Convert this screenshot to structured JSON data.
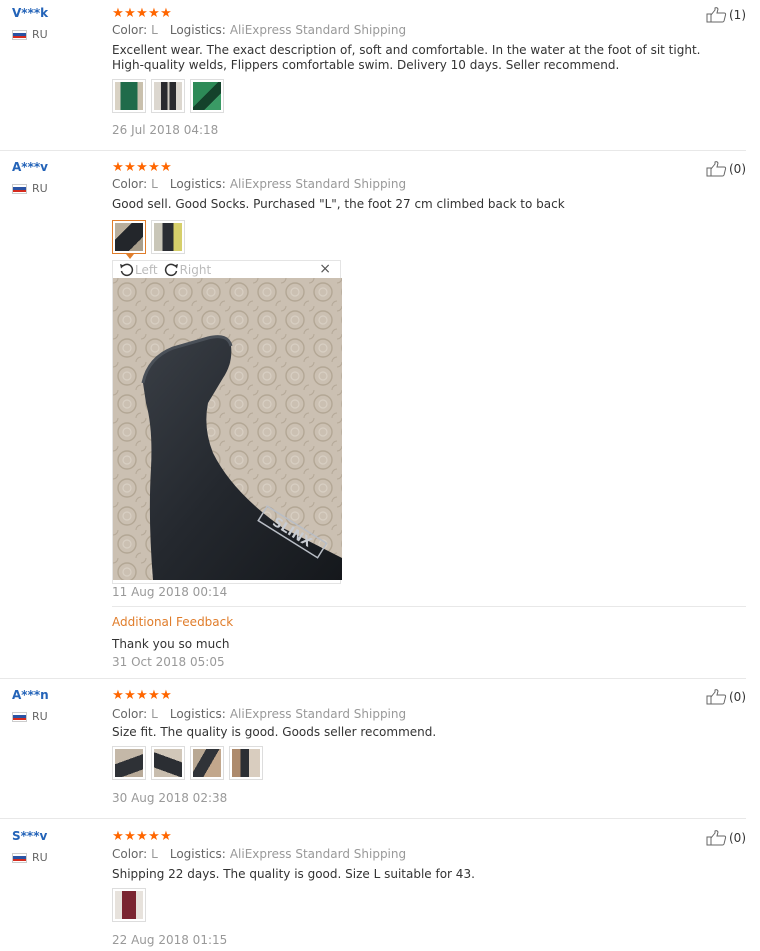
{
  "reviews": [
    {
      "user": "V***k",
      "country": "RU",
      "stars": 5,
      "helpful_label": "(1)",
      "color_key": "Color:",
      "color_val": "L",
      "logistics_key": "Logistics:",
      "logistics_val": "AliExpress Standard Shipping",
      "text": "Excellent wear. The exact description of, soft and comfortable. In the water at the foot of sit tight. High-quality welds, Flippers comfortable swim. Delivery 10 days. Seller recommend.",
      "date": "26 Jul 2018 04:18"
    },
    {
      "user": "A***v",
      "country": "RU",
      "stars": 5,
      "helpful_label": "(0)",
      "color_key": "Color:",
      "color_val": "L",
      "logistics_key": "Logistics:",
      "logistics_val": "AliExpress Standard Shipping",
      "text": "Good sell. Good Socks. Purchased \"L\", the foot 27 cm climbed back to back",
      "date": "11 Aug 2018 00:14",
      "viewer": {
        "rotate_left": "Left",
        "rotate_right": "Right",
        "close": "×",
        "sock_print": "SLINX"
      },
      "additional_title": "Additional Feedback",
      "additional_text": "Thank you so much",
      "additional_date": "31 Oct 2018 05:05"
    },
    {
      "user": "A***n",
      "country": "RU",
      "stars": 5,
      "helpful_label": "(0)",
      "color_key": "Color:",
      "color_val": "L",
      "logistics_key": "Logistics:",
      "logistics_val": "AliExpress Standard Shipping",
      "text": "Size fit. The quality is good. Goods seller recommend.",
      "date": "30 Aug 2018 02:38"
    },
    {
      "user": "S***v",
      "country": "RU",
      "stars": 5,
      "helpful_label": "(0)",
      "color_key": "Color:",
      "color_val": "L",
      "logistics_key": "Logistics:",
      "logistics_val": "AliExpress Standard Shipping",
      "text": "Shipping 22 days. The quality is good. Size L suitable for 43.",
      "date": "22 Aug 2018 01:15"
    }
  ],
  "colors": {
    "star": "#ff6600",
    "username": "#2363b8",
    "accent": "#e07d2b"
  },
  "icons": [
    "thumbs-up-icon",
    "star-icon",
    "ru-flag-icon",
    "rotate-left-icon",
    "rotate-right-icon",
    "close-icon"
  ]
}
